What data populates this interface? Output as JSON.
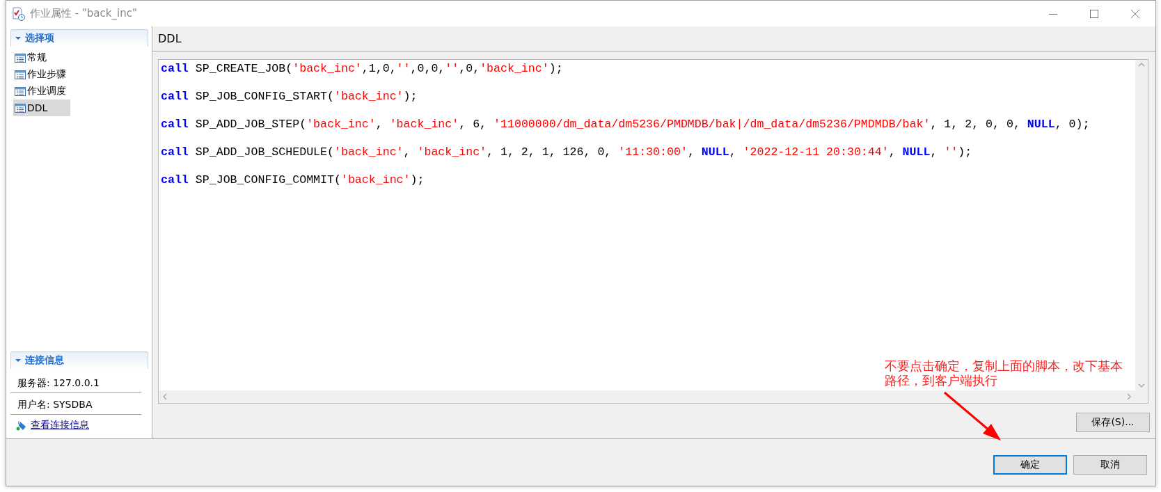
{
  "window": {
    "title": "作业属性 - \"back_inc\""
  },
  "sidebar": {
    "sections": [
      {
        "title": "选择项",
        "expanded": true,
        "items": [
          {
            "label": "常规",
            "selected": false
          },
          {
            "label": "作业步骤",
            "selected": false
          },
          {
            "label": "作业调度",
            "selected": false
          },
          {
            "label": "DDL",
            "selected": true
          }
        ]
      }
    ],
    "connection": {
      "title": "连接信息",
      "expanded": true,
      "fields": [
        "服务器: 127.0.0.1",
        "用户名: SYSDBA"
      ],
      "link": "查看连接信息"
    }
  },
  "panel": {
    "title": "DDL",
    "code_lines": [
      [
        {
          "kind": "keyword",
          "text": "call"
        },
        {
          "kind": "plain",
          "text": " SP_CREATE_JOB("
        },
        {
          "kind": "string",
          "text": "'back_inc'"
        },
        {
          "kind": "plain",
          "text": ",1,0,"
        },
        {
          "kind": "string",
          "text": "''"
        },
        {
          "kind": "plain",
          "text": ",0,0,"
        },
        {
          "kind": "string",
          "text": "''"
        },
        {
          "kind": "plain",
          "text": ",0,"
        },
        {
          "kind": "string",
          "text": "'back_inc'"
        },
        {
          "kind": "plain",
          "text": ");"
        }
      ],
      [
        {
          "kind": "keyword",
          "text": "call"
        },
        {
          "kind": "plain",
          "text": " SP_JOB_CONFIG_START("
        },
        {
          "kind": "string",
          "text": "'back_inc'"
        },
        {
          "kind": "plain",
          "text": ");"
        }
      ],
      [
        {
          "kind": "keyword",
          "text": "call"
        },
        {
          "kind": "plain",
          "text": " SP_ADD_JOB_STEP("
        },
        {
          "kind": "string",
          "text": "'back_inc'"
        },
        {
          "kind": "plain",
          "text": ", "
        },
        {
          "kind": "string",
          "text": "'back_inc'"
        },
        {
          "kind": "plain",
          "text": ", 6, "
        },
        {
          "kind": "string",
          "text": "'11000000/dm_data/dm5236/PMDMDB/bak|/dm_data/dm5236/PMDMDB/bak'"
        },
        {
          "kind": "plain",
          "text": ", 1, 2, 0, 0, "
        },
        {
          "kind": "keyword",
          "text": "NULL"
        },
        {
          "kind": "plain",
          "text": ", 0);"
        }
      ],
      [
        {
          "kind": "keyword",
          "text": "call"
        },
        {
          "kind": "plain",
          "text": " SP_ADD_JOB_SCHEDULE("
        },
        {
          "kind": "string",
          "text": "'back_inc'"
        },
        {
          "kind": "plain",
          "text": ", "
        },
        {
          "kind": "string",
          "text": "'back_inc'"
        },
        {
          "kind": "plain",
          "text": ", 1, 2, 1, 126, 0, "
        },
        {
          "kind": "string",
          "text": "'11:30:00'"
        },
        {
          "kind": "plain",
          "text": ", "
        },
        {
          "kind": "keyword",
          "text": "NULL"
        },
        {
          "kind": "plain",
          "text": ", "
        },
        {
          "kind": "string",
          "text": "'2022-12-11 20:30:44'"
        },
        {
          "kind": "plain",
          "text": ", "
        },
        {
          "kind": "keyword",
          "text": "NULL"
        },
        {
          "kind": "plain",
          "text": ", "
        },
        {
          "kind": "string",
          "text": "''"
        },
        {
          "kind": "plain",
          "text": ");"
        }
      ],
      [
        {
          "kind": "keyword",
          "text": "call"
        },
        {
          "kind": "plain",
          "text": " SP_JOB_CONFIG_COMMIT("
        },
        {
          "kind": "string",
          "text": "'back_inc'"
        },
        {
          "kind": "plain",
          "text": ");"
        }
      ]
    ],
    "save_button": "保存(S)..."
  },
  "buttons": [
    {
      "label": "确定",
      "default": true
    },
    {
      "label": "取消",
      "default": false
    }
  ],
  "annotation": {
    "text": "不要点击确定，复制上面的脚本，改下基本路径，到客户端执行"
  }
}
